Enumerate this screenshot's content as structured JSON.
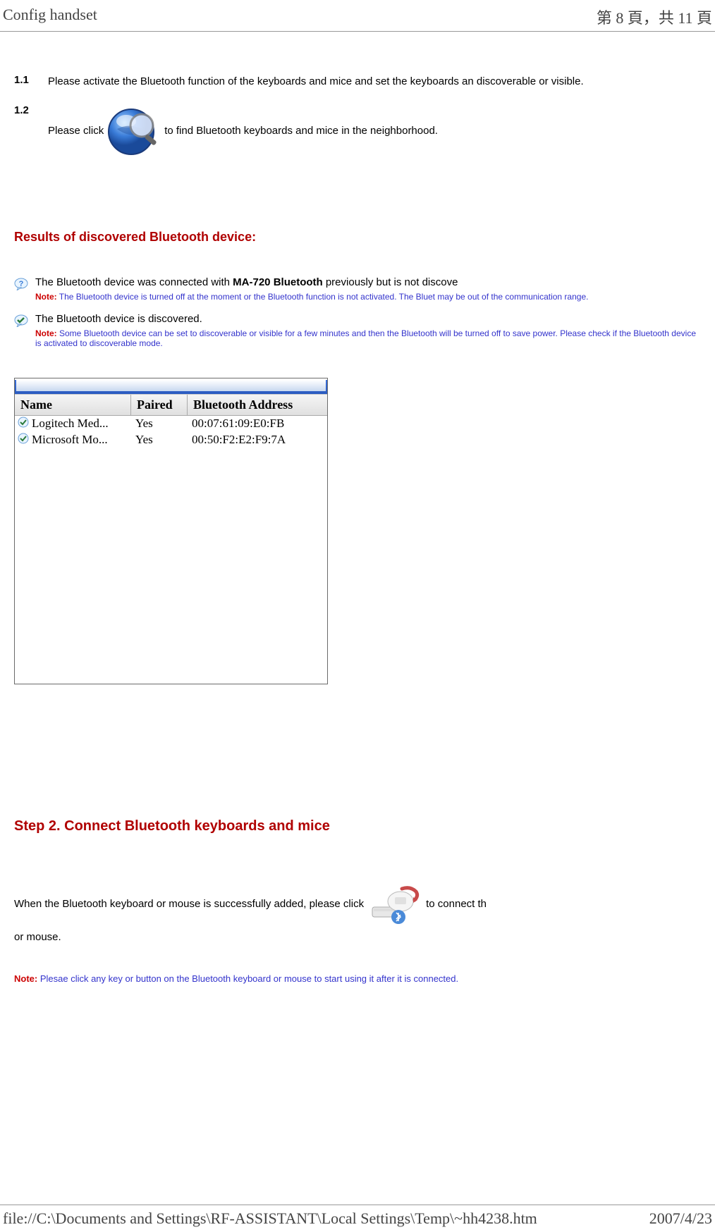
{
  "header": {
    "left": "Config handset",
    "right": "第 8 頁，共 11 頁"
  },
  "steps": [
    {
      "num": "1.1",
      "text": "Please activate the Bluetooth function of the keyboards and mice and set the keyboards an discoverable or visible."
    },
    {
      "num": "1.2",
      "text_before": "Please click ",
      "text_after": " to find Bluetooth keyboards and mice in the neighborhood."
    }
  ],
  "results": {
    "heading": "Results of discovered Bluetooth device:",
    "items": [
      {
        "text_before": "The Bluetooth device was connected with ",
        "bold": "MA-720 Bluetooth",
        "text_after": " previously but is not discove",
        "note_label": "Note:",
        "note": " The Bluetooth device is turned off at the moment or the Bluetooth function is not activated. The Bluet may be out of the communication range."
      },
      {
        "text": "The Bluetooth device is discovered.",
        "note_label": "Note:",
        "note": " Some Bluetooth device can be set to discoverable or visible for a few minutes and then the Bluetooth will be turned off to save power. Please check if the Bluetooth device is activated to discoverable mode."
      }
    ]
  },
  "table": {
    "headers": {
      "name": "Name",
      "paired": "Paired",
      "addr": "Bluetooth Address"
    },
    "rows": [
      {
        "name": "Logitech Med...",
        "paired": "Yes",
        "addr": "00:07:61:09:E0:FB"
      },
      {
        "name": "Microsoft Mo...",
        "paired": "Yes",
        "addr": "00:50:F2:E2:F9:7A"
      }
    ]
  },
  "step2": {
    "heading": "Step 2. Connect Bluetooth keyboards and mice",
    "text_before": "When the Bluetooth keyboard or mouse is successfully added, please click ",
    "text_after": " to connect th",
    "text_line2": "or mouse.",
    "note_label": "Note:",
    "note": " Plesae click any key or button on the Bluetooth keyboard or mouse to start using it after it is connected."
  },
  "footer": {
    "left": "file://C:\\Documents and Settings\\RF-ASSISTANT\\Local Settings\\Temp\\~hh4238.htm",
    "right": "2007/4/23"
  }
}
